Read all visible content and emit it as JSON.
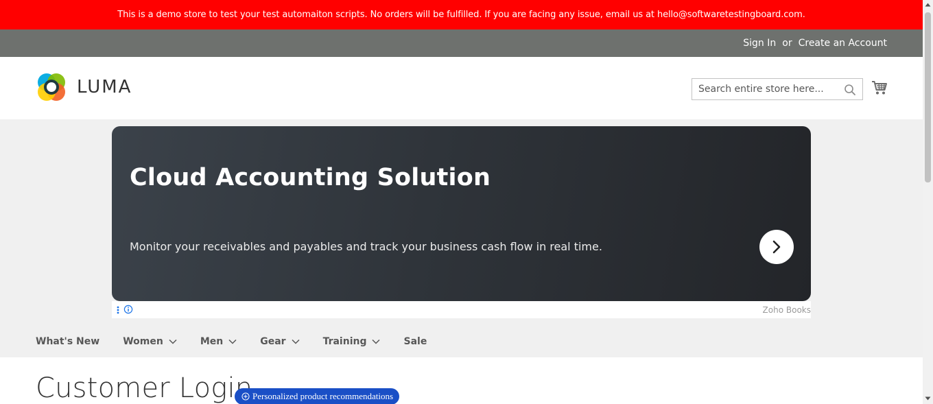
{
  "demo_notice": "This is a demo store to test your test automaiton scripts. No orders will be fulfilled. If you are facing any issue, email us at hello@softwaretestingboard.com.",
  "header_links": {
    "sign_in": "Sign In",
    "or": "or",
    "create_account": "Create an Account"
  },
  "logo": {
    "text": "LUMA",
    "colors": [
      "#00a9e0",
      "#7fba00",
      "#f25f22",
      "#ffce00"
    ]
  },
  "search": {
    "placeholder": "Search entire store here...",
    "value": "",
    "icon": "search-icon"
  },
  "cart": {
    "icon": "shopping-cart-icon"
  },
  "ad": {
    "title": "Cloud Accounting Solution",
    "description": "Monitor your receivables and payables and track your business cash flow in real time.",
    "brand": "Zoho Books",
    "arrow_icon": "chevron-right-icon",
    "info_icon": "info-icon",
    "menu_icon": "vertical-dots-icon"
  },
  "nav": {
    "items": [
      {
        "label": "What's New",
        "has_dropdown": false
      },
      {
        "label": "Women",
        "has_dropdown": true
      },
      {
        "label": "Men",
        "has_dropdown": true
      },
      {
        "label": "Gear",
        "has_dropdown": true
      },
      {
        "label": "Training",
        "has_dropdown": true
      },
      {
        "label": "Sale",
        "has_dropdown": false
      }
    ]
  },
  "page": {
    "title": "Customer Login",
    "recommendation_badge": "Personalized product recommendations"
  },
  "colors": {
    "demo_bar": "#ff0000",
    "header_panel": "#6e716e",
    "badge": "#1a4fc6"
  }
}
